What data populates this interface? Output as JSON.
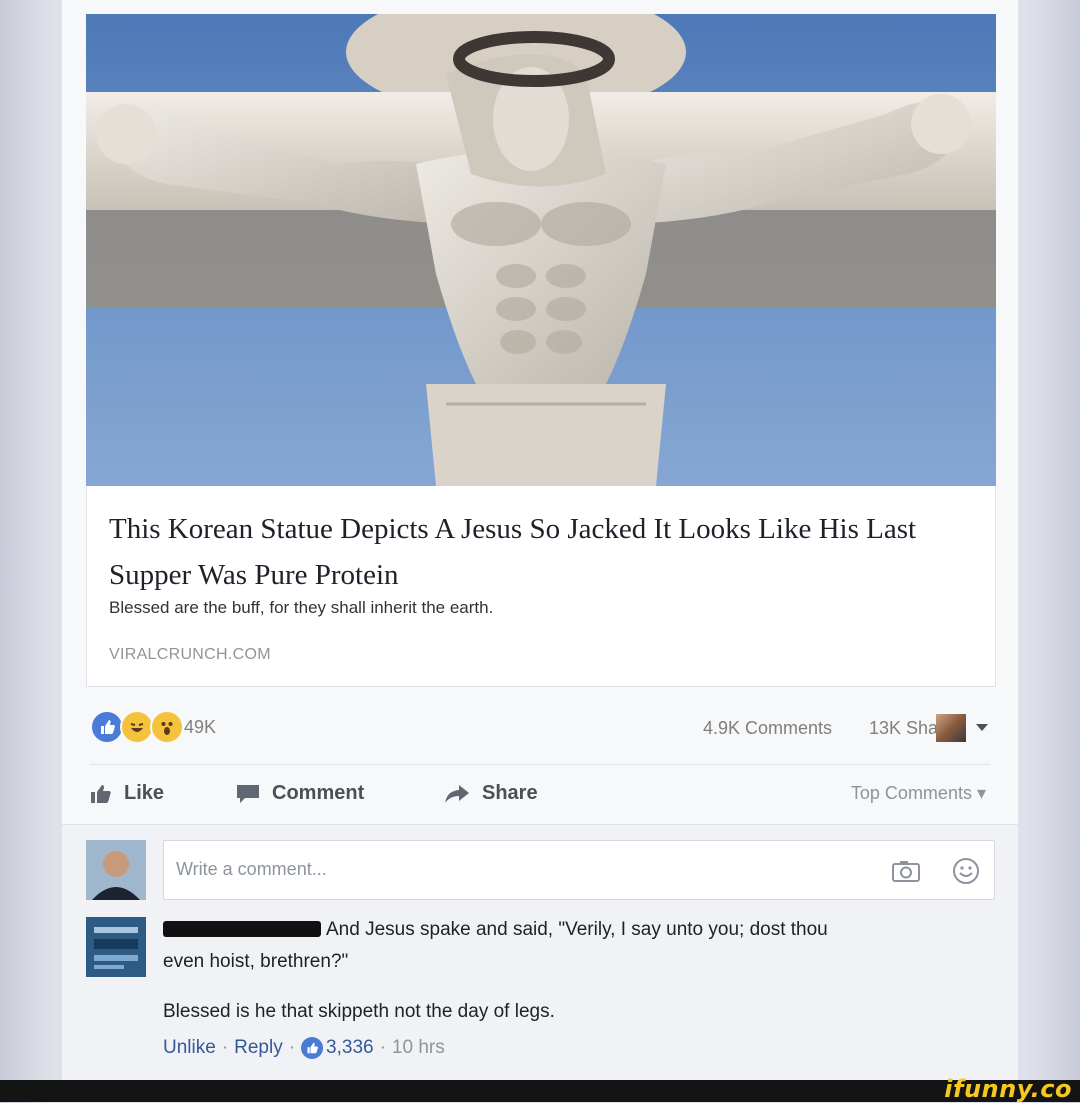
{
  "post": {
    "link": {
      "title": "This Korean Statue Depicts A Jesus So Jacked It Looks Like His Last Supper Was Pure Protein",
      "description": "Blessed are the buff, for they shall inherit the earth.",
      "domain": "VIRALCRUNCH.COM"
    },
    "stats": {
      "reaction_icons": [
        "like-reaction-icon",
        "haha-reaction-icon",
        "wow-reaction-icon"
      ],
      "reactions_count": "49K",
      "comments_count": "4.9K Comments",
      "shares_count": "13K Shares"
    },
    "actions": {
      "like": "Like",
      "comment": "Comment",
      "share": "Share",
      "top_comments": "Top Comments ▾"
    },
    "composer": {
      "placeholder": "Write a comment..."
    },
    "comment": {
      "text_line1": "And Jesus spake and said, \"Verily, I say unto you; dost thou",
      "text_line2": "even hoist, brethren?\"",
      "reply_text": "Blessed is he that skippeth not the day of legs.",
      "unlike": "Unlike",
      "reply": "Reply",
      "likes": "3,336",
      "time": "10 hrs"
    }
  },
  "watermark": "ifunny.co",
  "colors": {
    "accent": "#365899",
    "like_blue": "#4a7bd6",
    "watermark_yellow": "#f5c81e"
  }
}
